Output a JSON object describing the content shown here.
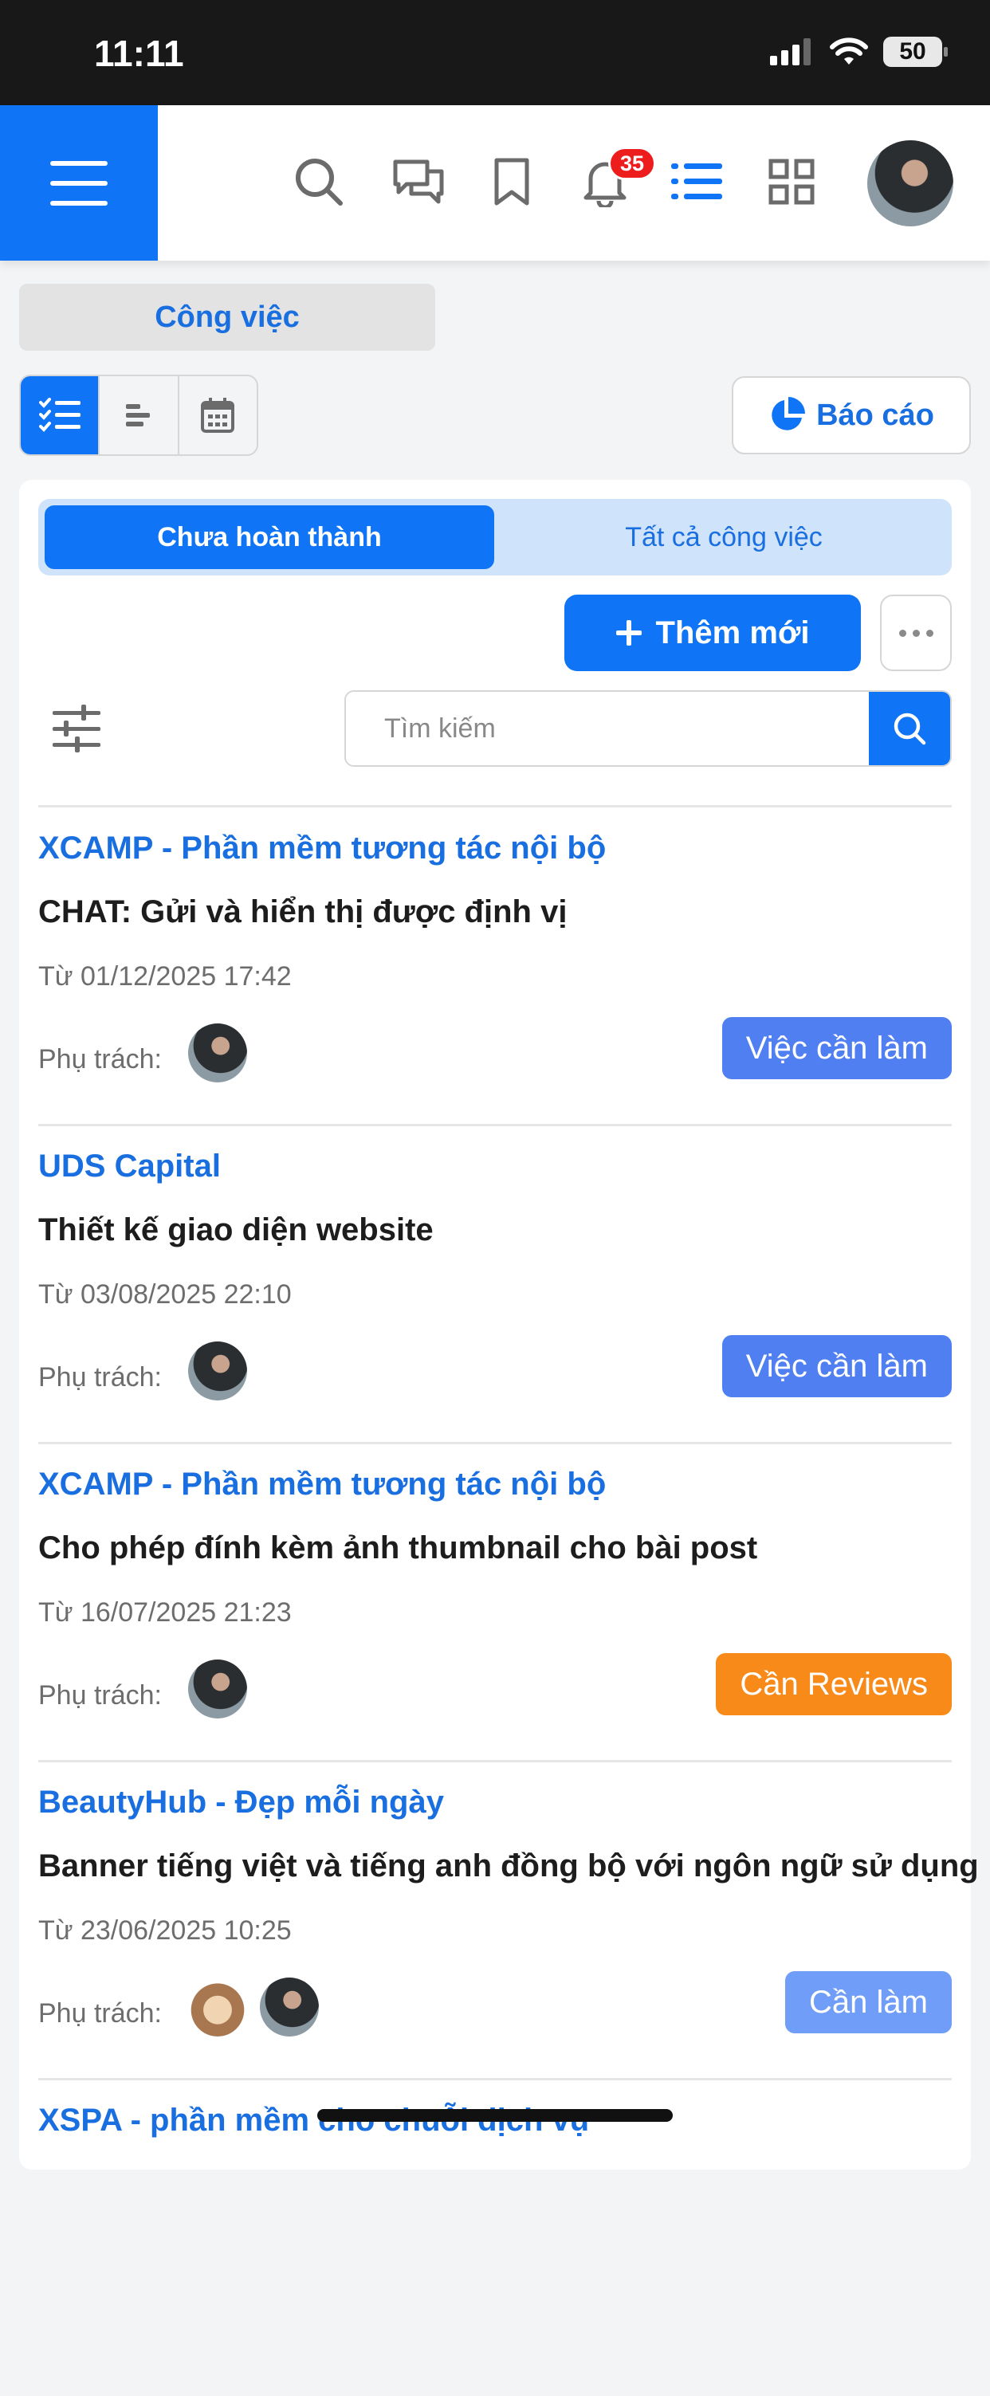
{
  "status_bar": {
    "time": "11:11",
    "battery": "50"
  },
  "header": {
    "notification_count": "35"
  },
  "section": {
    "title": "Công việc"
  },
  "toolbar": {
    "report_label": "Báo cáo"
  },
  "tabs": {
    "active": "Chưa hoàn thành",
    "inactive": "Tất cả công việc"
  },
  "actions": {
    "add_label": "Thêm mới"
  },
  "search": {
    "placeholder": "Tìm kiếm"
  },
  "owner_label": "Phụ trách:",
  "tasks": [
    {
      "project": "XCAMP - Phần mềm tương tác nội bộ",
      "title": "CHAT: Gửi và hiển thị được định vị",
      "date": "Từ 01/12/2025 17:42",
      "status": "Việc cần làm",
      "status_color": "#4f7ff0"
    },
    {
      "project": "UDS Capital",
      "title": "Thiết kế giao diện website",
      "date": "Từ 03/08/2025 22:10",
      "status": "Việc cần làm",
      "status_color": "#4f7ff0"
    },
    {
      "project": "XCAMP - Phần mềm tương tác nội bộ",
      "title": "Cho phép đính kèm ảnh thumbnail cho bài post",
      "date": "Từ 16/07/2025 21:23",
      "status": "Cần Reviews",
      "status_color": "#f88a1a"
    },
    {
      "project": "BeautyHub - Đẹp mỗi ngày",
      "title": "Banner tiếng việt và tiếng anh đồng bộ với ngôn ngữ sử dụng",
      "date": "Từ 23/06/2025 10:25",
      "status": "Cần làm",
      "status_color": "#6f9df7"
    },
    {
      "project": "XSPA - phần mềm cho chuỗi dịch vụ"
    }
  ],
  "colors": {
    "primary": "#0f74f5",
    "link": "#1a6fe0",
    "badge": "#ee1d1d"
  }
}
